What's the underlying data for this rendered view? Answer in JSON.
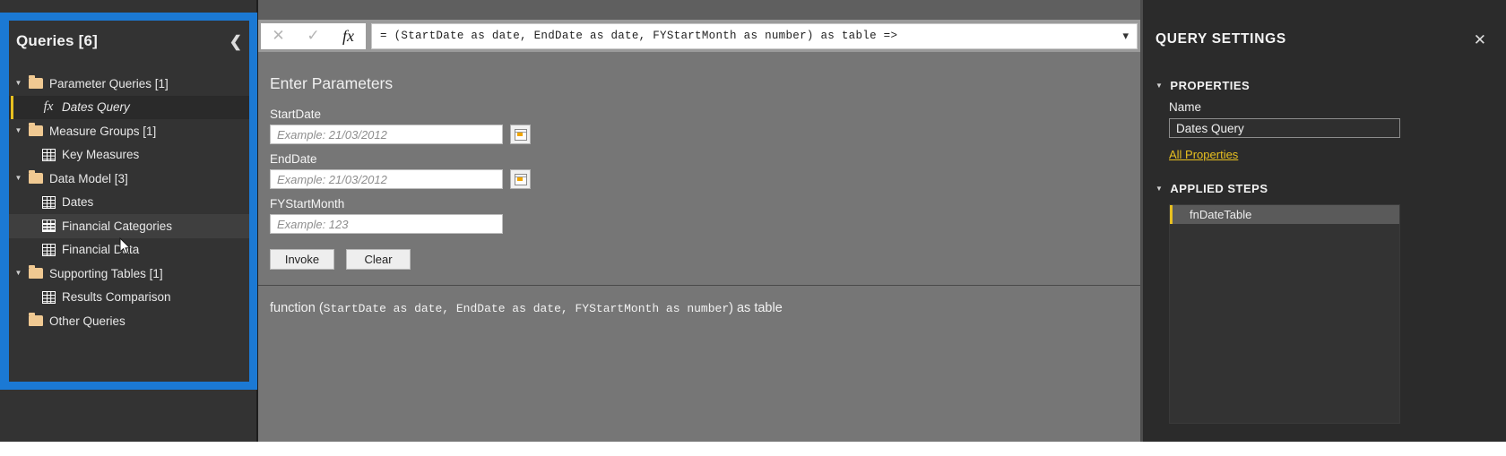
{
  "sidebar": {
    "title": "Queries [6]",
    "collapse_icon": "chevron-left-icon",
    "tree": [
      {
        "label": "Parameter Queries [1]",
        "type": "folder",
        "level": 1,
        "expanded": true,
        "state": "normal"
      },
      {
        "label": "Dates Query",
        "type": "function",
        "level": 2,
        "expanded": false,
        "state": "selected"
      },
      {
        "label": "Measure Groups [1]",
        "type": "folder",
        "level": 1,
        "expanded": true,
        "state": "normal"
      },
      {
        "label": "Key Measures",
        "type": "table",
        "level": 2,
        "expanded": false,
        "state": "normal"
      },
      {
        "label": "Data Model [3]",
        "type": "folder",
        "level": 1,
        "expanded": true,
        "state": "normal"
      },
      {
        "label": "Dates",
        "type": "table",
        "level": 2,
        "expanded": false,
        "state": "normal"
      },
      {
        "label": "Financial Categories",
        "type": "table",
        "level": 2,
        "expanded": false,
        "state": "hovered"
      },
      {
        "label": "Financial Data",
        "type": "table",
        "level": 2,
        "expanded": false,
        "state": "normal"
      },
      {
        "label": "Supporting Tables [1]",
        "type": "folder",
        "level": 1,
        "expanded": true,
        "state": "normal"
      },
      {
        "label": "Results Comparison",
        "type": "table",
        "level": 2,
        "expanded": false,
        "state": "normal"
      },
      {
        "label": "Other Queries",
        "type": "folder",
        "level": 1,
        "expanded": false,
        "state": "normal"
      }
    ]
  },
  "formula_bar": {
    "cancel_icon": "close-icon",
    "accept_icon": "check-icon",
    "fx_icon": "fx-icon",
    "formula": "= (StartDate as date, EndDate as date, FYStartMonth as number) as table =>",
    "expand_icon": "chevron-down-icon"
  },
  "parameters": {
    "heading": "Enter Parameters",
    "fields": [
      {
        "label": "StartDate",
        "value": "",
        "placeholder": "Example: 21/03/2012",
        "has_date_picker": true,
        "date_picker_icon": "calendar-icon"
      },
      {
        "label": "EndDate",
        "value": "",
        "placeholder": "Example: 21/03/2012",
        "has_date_picker": true,
        "date_picker_icon": "calendar-icon"
      },
      {
        "label": "FYStartMonth",
        "value": "",
        "placeholder": "Example: 123",
        "has_date_picker": false,
        "date_picker_icon": ""
      }
    ],
    "invoke_label": "Invoke",
    "clear_label": "Clear",
    "signature_prefix": "function (",
    "signature_args": "StartDate as date, EndDate as date, FYStartMonth as number",
    "signature_suffix": ") as table"
  },
  "query_settings": {
    "title": "QUERY SETTINGS",
    "close_icon": "close-icon",
    "properties_heading": "PROPERTIES",
    "name_label": "Name",
    "name_value": "Dates Query",
    "all_properties_link": "All Properties",
    "applied_steps_heading": "APPLIED STEPS",
    "steps": [
      {
        "label": "fnDateTable",
        "selected": true
      }
    ]
  },
  "colors": {
    "highlight_blue": "#1b79d4",
    "sidebar_bg": "#333333",
    "center_bg": "#767676",
    "panel_bg": "#2b2b2b",
    "accent_gold": "#e8c020",
    "folder_tan": "#f0c992"
  }
}
